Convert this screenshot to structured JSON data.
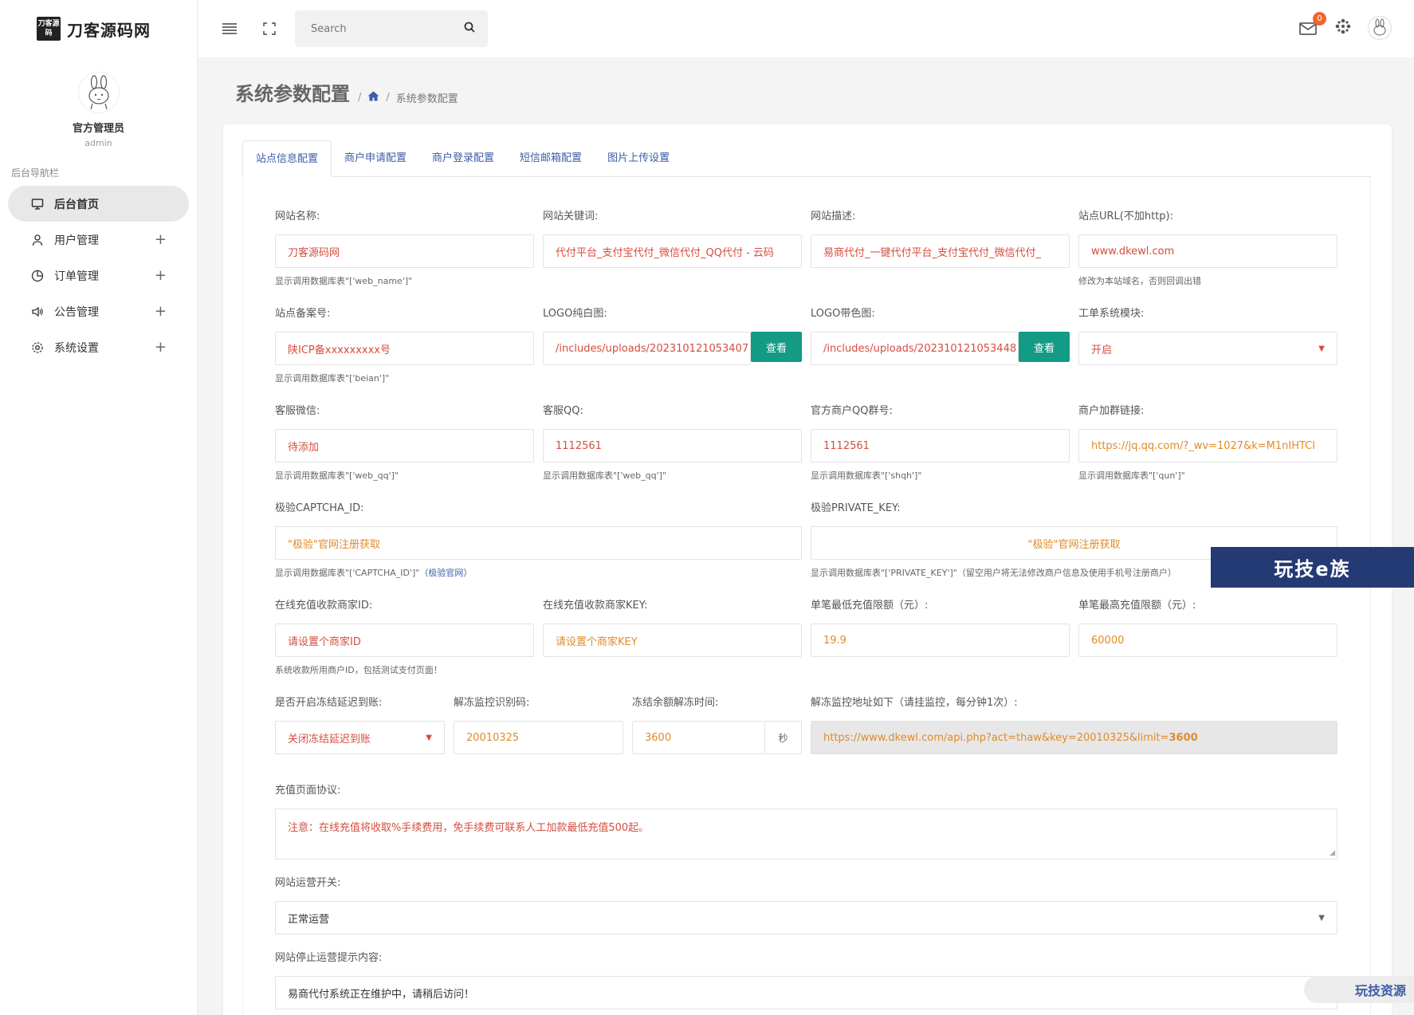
{
  "brand": {
    "logo_text": "刀客源码",
    "name": "刀客源码网"
  },
  "profile": {
    "name": "官方管理员",
    "role": "admin"
  },
  "nav": {
    "caption": "后台导航栏",
    "items": [
      {
        "label": "后台首页",
        "icon": "monitor-icon"
      },
      {
        "label": "用户管理",
        "icon": "user-icon",
        "plus": "+"
      },
      {
        "label": "订单管理",
        "icon": "pie-chart-icon",
        "plus": "+"
      },
      {
        "label": "公告管理",
        "icon": "speaker-icon",
        "plus": "+"
      },
      {
        "label": "系统设置",
        "icon": "gear-icon",
        "plus": "+"
      }
    ]
  },
  "topbar": {
    "search_placeholder": "Search",
    "mail_count": "0"
  },
  "page": {
    "title": "系统参数配置",
    "breadcrumb_current": "系统参数配置",
    "sep": "/"
  },
  "tabs": [
    "站点信息配置",
    "商户申请配置",
    "商户登录配置",
    "短信邮箱配置",
    "图片上传设置"
  ],
  "form": {
    "web_name": {
      "label": "网站名称:",
      "value": "刀客源码网",
      "help": "显示调用数据库表\"['web_name']\""
    },
    "keywords": {
      "label": "网站关键词:",
      "value": "代付平台_支付宝代付_微信代付_QQ代付 - 云码"
    },
    "description": {
      "label": "网站描述:",
      "value": "易商代付_一键代付平台_支付宝代付_微信代付_"
    },
    "site_url": {
      "label": "站点URL(不加http):",
      "value": "www.dkewl.com",
      "help": "修改为本站域名，否则回调出错"
    },
    "beian": {
      "label": "站点备案号:",
      "value": "陕ICP备xxxxxxxxx号",
      "help": "显示调用数据库表\"['beian']\""
    },
    "logo_white": {
      "label": "LOGO纯白图:",
      "value": "/includes/uploads/202310121053407",
      "button": "查看"
    },
    "logo_color": {
      "label": "LOGO带色图:",
      "value": "/includes/uploads/202310121053448",
      "button": "查看"
    },
    "ticket": {
      "label": "工单系统模块:",
      "value": "开启"
    },
    "wechat": {
      "label": "客服微信:",
      "value": "待添加",
      "help": "显示调用数据库表\"['web_qq']\""
    },
    "qq": {
      "label": "客服QQ:",
      "value": "1112561",
      "help": "显示调用数据库表\"['web_qq']\""
    },
    "qq_group": {
      "label": "官方商户QQ群号:",
      "value": "1112561",
      "help": "显示调用数据库表\"['shqh']\""
    },
    "group_link": {
      "label": "商户加群链接:",
      "value": "https://jq.qq.com/?_wv=1027&k=M1nIHTCI",
      "help": "显示调用数据库表\"['qun']\""
    },
    "captcha_id": {
      "label": "极验CAPTCHA_ID:",
      "value": "\"极验\"官网注册获取",
      "help": "显示调用数据库表\"['CAPTCHA_ID']\"",
      "help_link": "（极验官网）"
    },
    "private_key": {
      "label": "极验PRIVATE_KEY:",
      "value": "\"极验\"官网注册获取",
      "help": "显示调用数据库表\"['PRIVATE_KEY']\"（留空用户将无法修改商户信息及使用手机号注册商户）"
    },
    "merchant_id": {
      "label": "在线充值收款商家ID:",
      "value": "请设置个商家ID",
      "help": "系统收款所用商户ID，包括测试支付页面！"
    },
    "merchant_key": {
      "label": "在线充值收款商家KEY:",
      "value": "请设置个商家KEY"
    },
    "min_recharge": {
      "label": "单笔最低充值限额（元）:",
      "value": "19.9"
    },
    "max_recharge": {
      "label": "单笔最高充值限额（元）:",
      "value": "60000"
    },
    "freeze": {
      "label": "是否开启冻结延迟到账:",
      "value": "关闭冻结延迟到账"
    },
    "thaw_code": {
      "label": "解冻监控识别码:",
      "value": "20010325"
    },
    "thaw_time": {
      "label": "冻结余额解冻时间:",
      "value": "3600",
      "unit": "秒"
    },
    "thaw_url": {
      "label": "解冻监控地址如下（请挂监控，每分钟1次）:",
      "value": "https://www.dkewl.com/api.php?act=thaw&key=20010325&limit=",
      "value_strong": "3600"
    },
    "agreement": {
      "label": "充值页面协议:",
      "value": "注意：在线充值将收取%手续费用，免手续费可联系人工加款最低充值500起。"
    },
    "operation": {
      "label": "网站运营开关:",
      "value": "正常运营"
    },
    "stop_msg": {
      "label": "网站停止运营提示内容:",
      "value": "易商代付系统正在维护中，请稍后访问！"
    }
  },
  "watermarks": {
    "banner": "玩技e族",
    "corner": "玩技资源"
  }
}
